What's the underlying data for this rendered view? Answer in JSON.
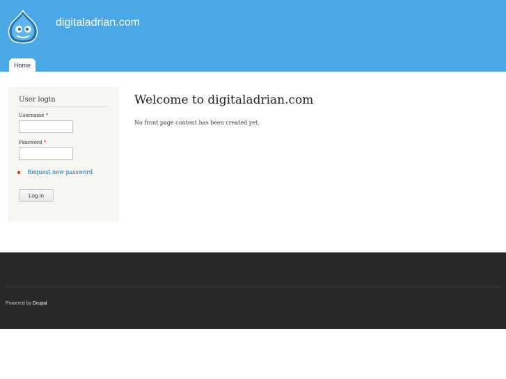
{
  "header": {
    "site_name": "digitaladrian.com",
    "logo_icon": "drupal-drop-icon",
    "bg_color": "#4aa8e6"
  },
  "tabs": [
    {
      "label": "Home",
      "active": true
    }
  ],
  "sidebar": {
    "block_title": "User login",
    "username_label": "Username",
    "username_value": "",
    "password_label": "Password",
    "password_value": "",
    "required_mark": "*",
    "request_password_link": "Request new password",
    "login_button": "Log in"
  },
  "main": {
    "title": "Welcome to digitaladrian.com",
    "body_text": "No front page content has been created yet."
  },
  "footer": {
    "powered_prefix": "Powered by",
    "powered_link": "Drupal",
    "bg_color": "#292929"
  }
}
